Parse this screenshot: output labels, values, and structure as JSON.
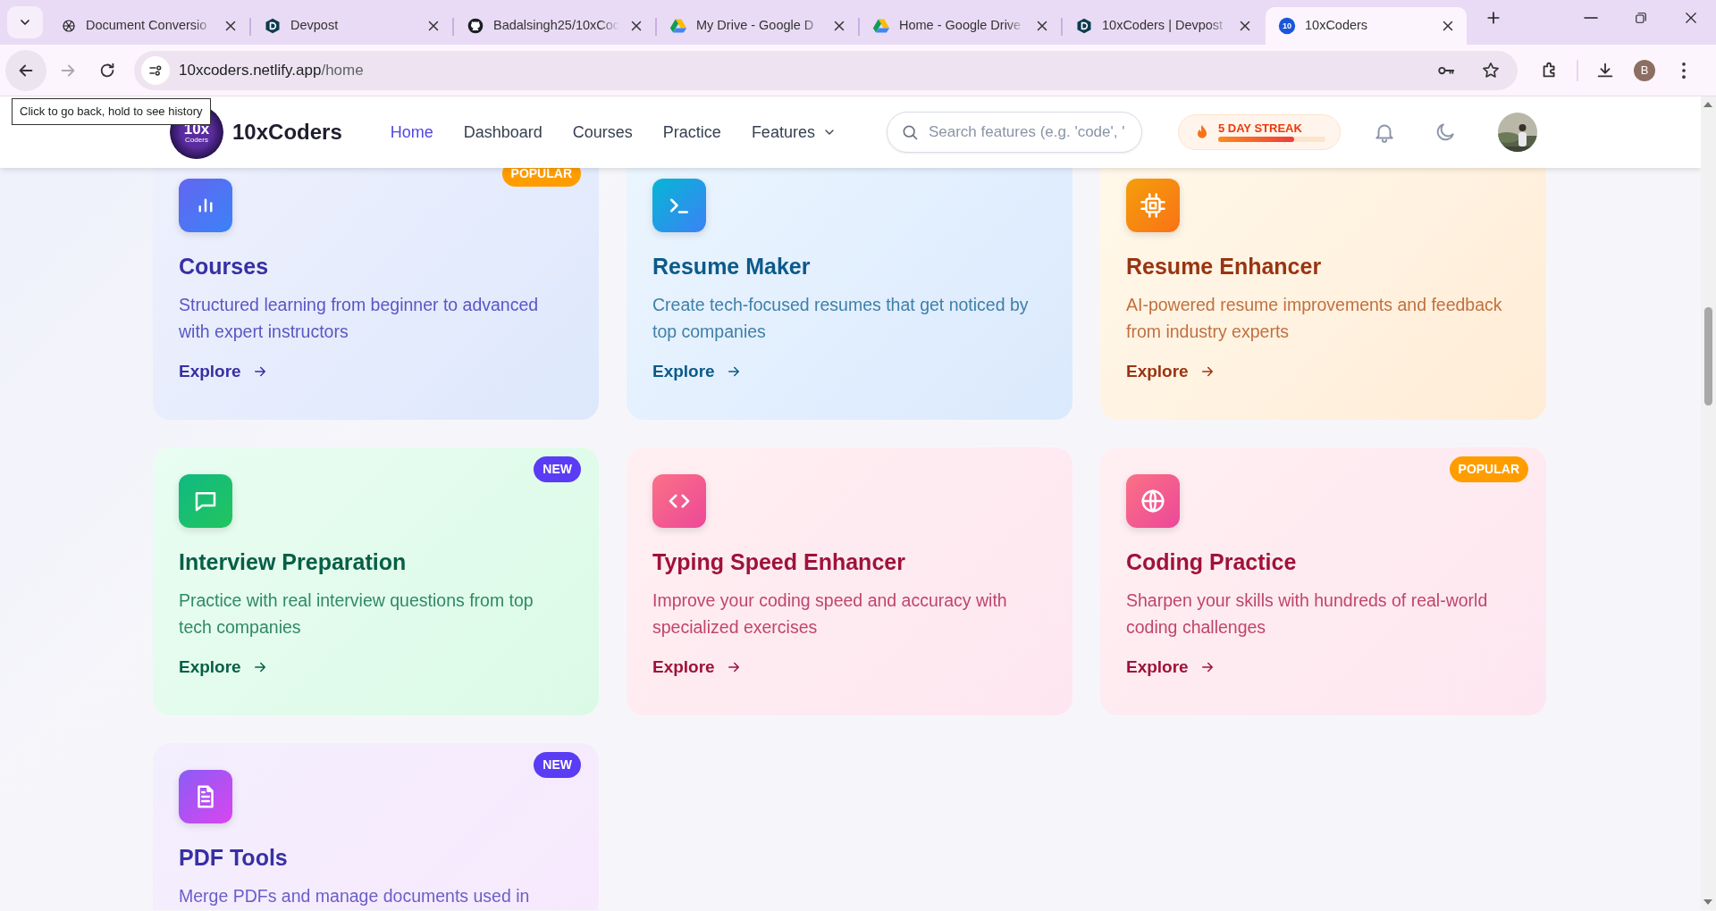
{
  "browser": {
    "tabs": [
      {
        "title": "Document Conversio",
        "kind": "openai",
        "selected": false
      },
      {
        "title": "Devpost",
        "kind": "devpost",
        "selected": false
      },
      {
        "title": "Badalsingh25/10xCoc",
        "kind": "github",
        "selected": false
      },
      {
        "title": "My Drive - Google D",
        "kind": "drive",
        "selected": false
      },
      {
        "title": "Home - Google Drive",
        "kind": "drive",
        "selected": false
      },
      {
        "title": "10xCoders | Devpost",
        "kind": "devpost",
        "selected": false
      },
      {
        "title": "10xCoders",
        "kind": "app",
        "selected": true
      }
    ],
    "favicon_text": "10",
    "address": {
      "domain": "10xcoders.netlify.app",
      "path": "/home"
    },
    "profile_initial": "B",
    "tooltip": "Click to go back, hold to see history"
  },
  "navbar": {
    "logo_lines": [
      "10x",
      "Coders"
    ],
    "brand": "10xCoders",
    "links": [
      {
        "label": "Home",
        "selected": true,
        "kind": "link"
      },
      {
        "label": "Dashboard",
        "selected": false,
        "kind": "link"
      },
      {
        "label": "Courses",
        "selected": false,
        "kind": "link"
      },
      {
        "label": "Practice",
        "selected": false,
        "kind": "link"
      },
      {
        "label": "Features",
        "selected": false,
        "kind": "dropdown"
      }
    ],
    "search": {
      "placeholder": "Search features (e.g. 'code', '"
    },
    "streak": {
      "label": "5 DAY STREAK",
      "level": 0.71
    }
  },
  "features": [
    {
      "kind": "courses",
      "title": "Courses",
      "description": "Structured learning from beginner to advanced with expert instructors",
      "cta": "Explore",
      "badge": {
        "text": "POPULAR",
        "kind": "popular"
      }
    },
    {
      "kind": "resume",
      "title": "Resume Maker",
      "description": "Create tech-focused resumes that get noticed by top companies",
      "cta": "Explore"
    },
    {
      "kind": "enhancer",
      "title": "Resume Enhancer",
      "description": "AI-powered resume improvements and feedback from industry experts",
      "cta": "Explore"
    },
    {
      "kind": "interview",
      "title": "Interview Preparation",
      "description": "Practice with real interview questions from top tech companies",
      "cta": "Explore",
      "badge": {
        "text": "NEW",
        "kind": "new"
      }
    },
    {
      "kind": "typing",
      "title": "Typing Speed Enhancer",
      "description": "Improve your coding speed and accuracy with specialized exercises",
      "cta": "Explore"
    },
    {
      "kind": "coding",
      "title": "Coding Practice",
      "description": "Sharpen your skills with hundreds of real-world coding challenges",
      "cta": "Explore",
      "badge": {
        "text": "POPULAR",
        "kind": "popular"
      }
    },
    {
      "kind": "pdf",
      "title": "PDF Tools",
      "description": "Merge PDFs and manage documents used in",
      "badge": {
        "text": "NEW",
        "kind": "new"
      }
    }
  ]
}
